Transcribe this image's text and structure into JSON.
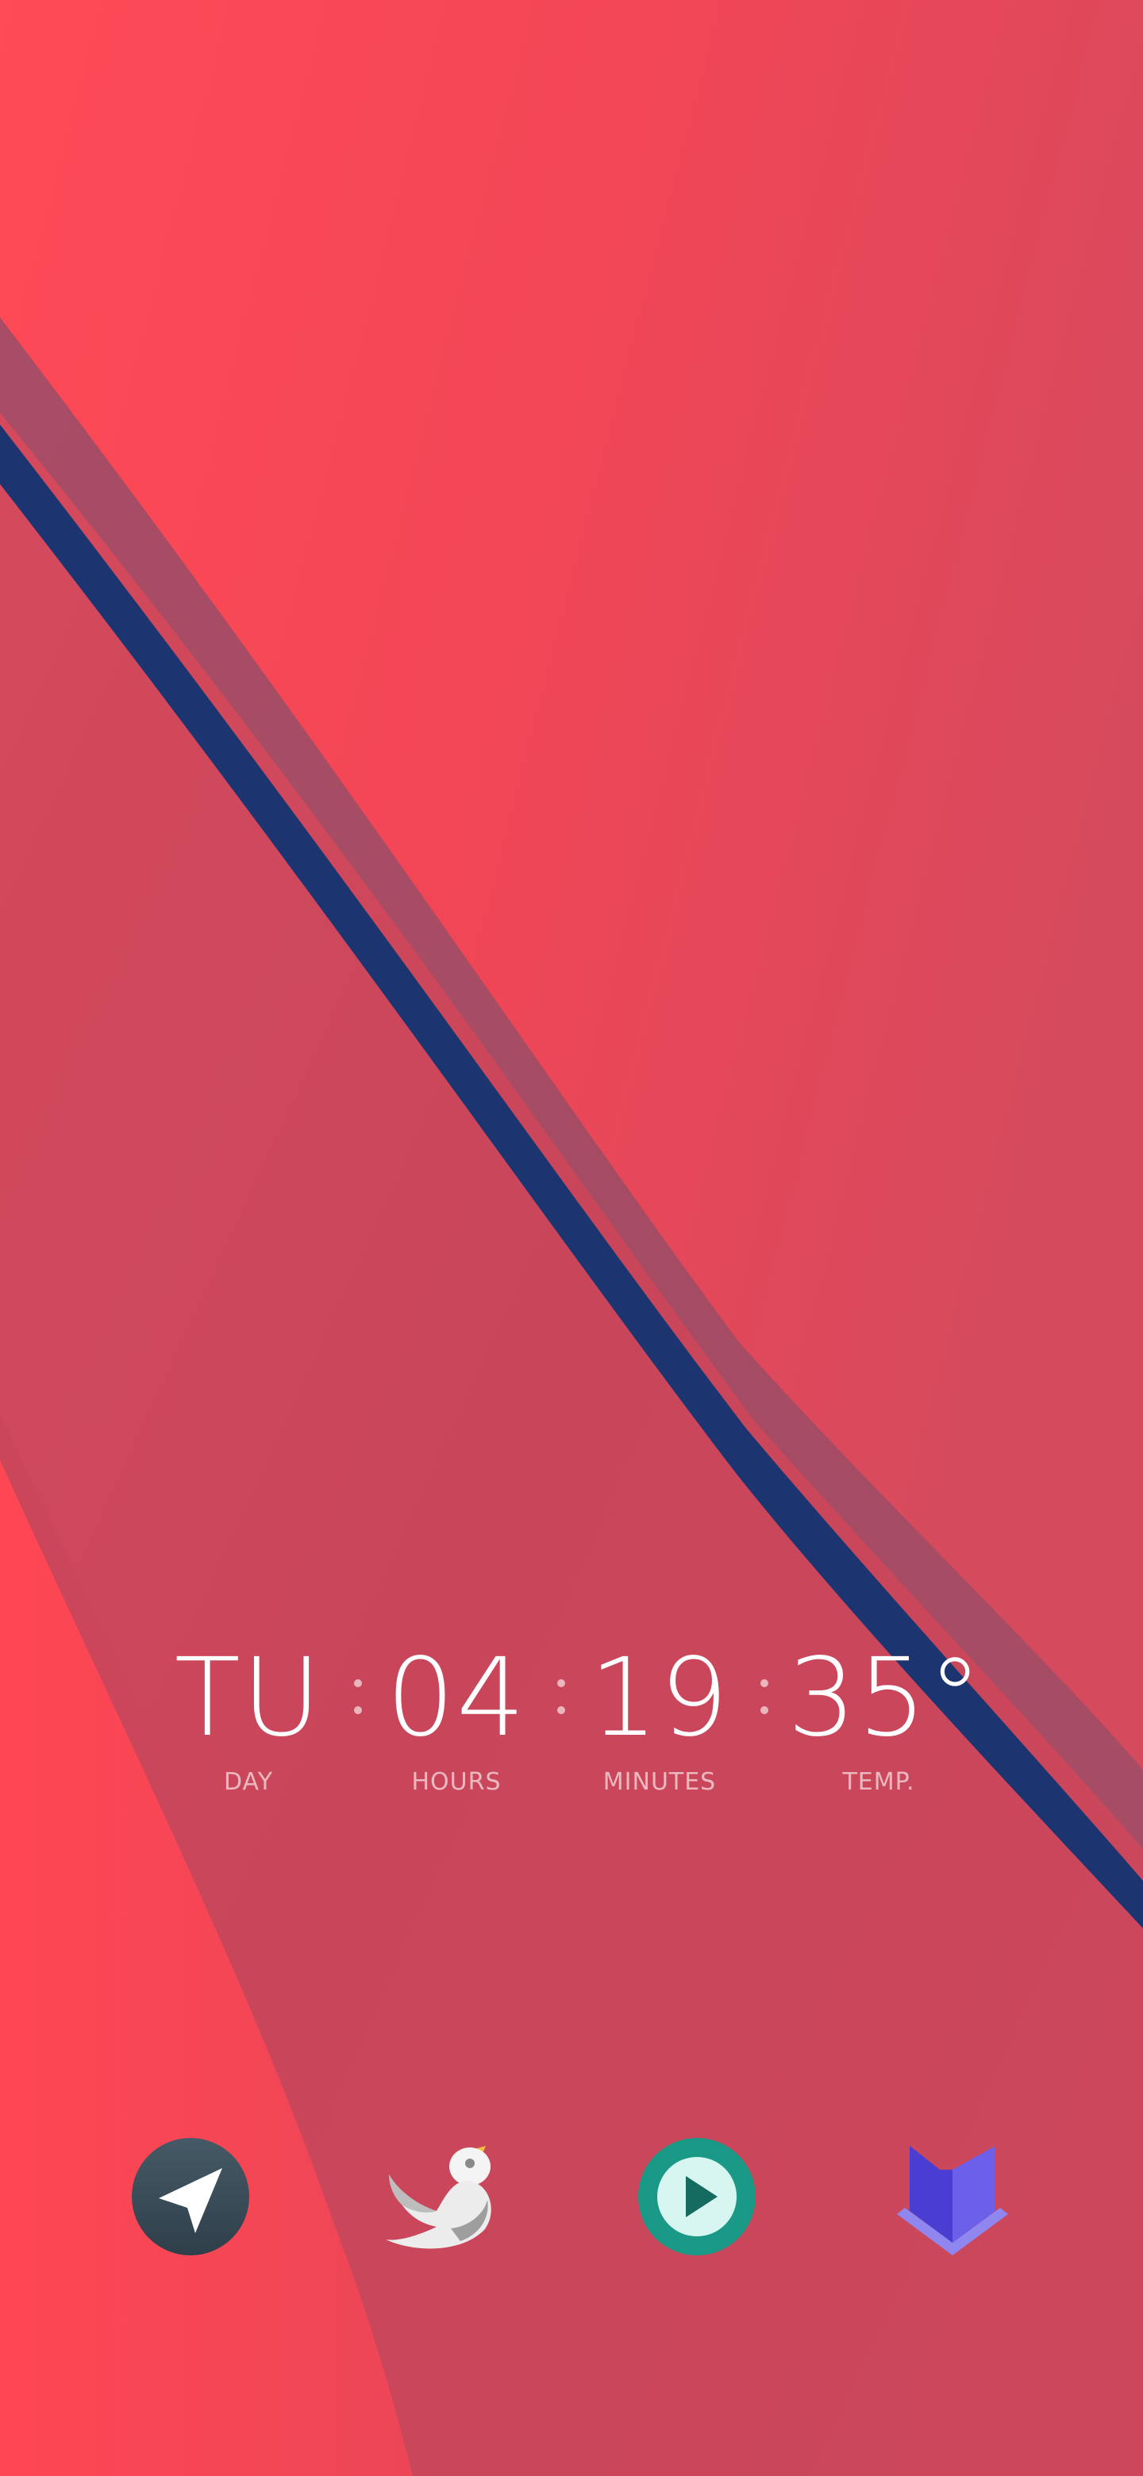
{
  "clock": {
    "day": {
      "value": "TU",
      "label": "DAY"
    },
    "hours": {
      "value": "04",
      "label": "HOURS"
    },
    "minutes": {
      "value": "19",
      "label": "MINUTES"
    },
    "temp": {
      "value": "35°",
      "label": "TEMP."
    }
  },
  "dock": {
    "apps": [
      {
        "icon": "navigation-arrow-icon",
        "color": "#37474f"
      },
      {
        "icon": "bird-icon",
        "color": "#e0e0e0"
      },
      {
        "icon": "play-icon",
        "color": "#1a9a86"
      },
      {
        "icon": "fox-icon",
        "color": "#5b4fd6"
      }
    ]
  },
  "colors": {
    "wallpaper_base": "#c9465a",
    "wallpaper_bright": "#ff4654",
    "stripe_navy": "#1c3570"
  }
}
